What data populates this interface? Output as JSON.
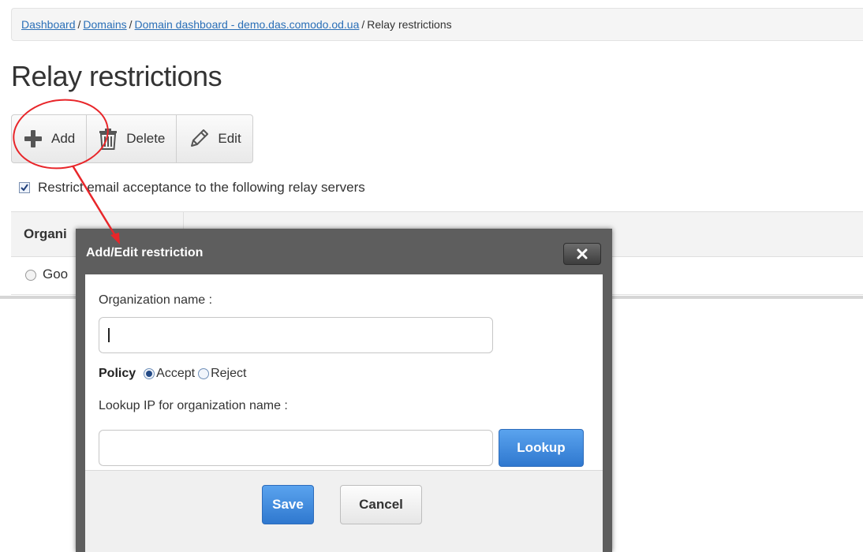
{
  "breadcrumb": {
    "links": [
      "Dashboard",
      "Domains",
      "Domain dashboard - demo.das.comodo.od.ua"
    ],
    "separator": "/",
    "current": "Relay restrictions"
  },
  "page_title": "Relay restrictions",
  "toolbar": {
    "add_label": "Add",
    "delete_label": "Delete",
    "edit_label": "Edit"
  },
  "restrict_checkbox": {
    "label": "Restrict email acceptance to the following relay servers",
    "checked": true
  },
  "table": {
    "column_header": "Organi",
    "rows": [
      "Goo"
    ]
  },
  "dialog": {
    "title": "Add/Edit restriction",
    "close_icon": "x",
    "org_label": "Organization name :",
    "org_value": "",
    "policy_label": "Policy",
    "policy_options": [
      "Accept",
      "Reject"
    ],
    "policy_selected": "Accept",
    "lookup_label": "Lookup IP for organization name :",
    "lookup_value": "",
    "lookup_button": "Lookup",
    "save_button": "Save",
    "cancel_button": "Cancel"
  },
  "colors": {
    "annotation": "#e8262a",
    "primary_button": "#3580d4",
    "link": "#2a6fb7",
    "modal_frame": "#5e5e5e"
  }
}
